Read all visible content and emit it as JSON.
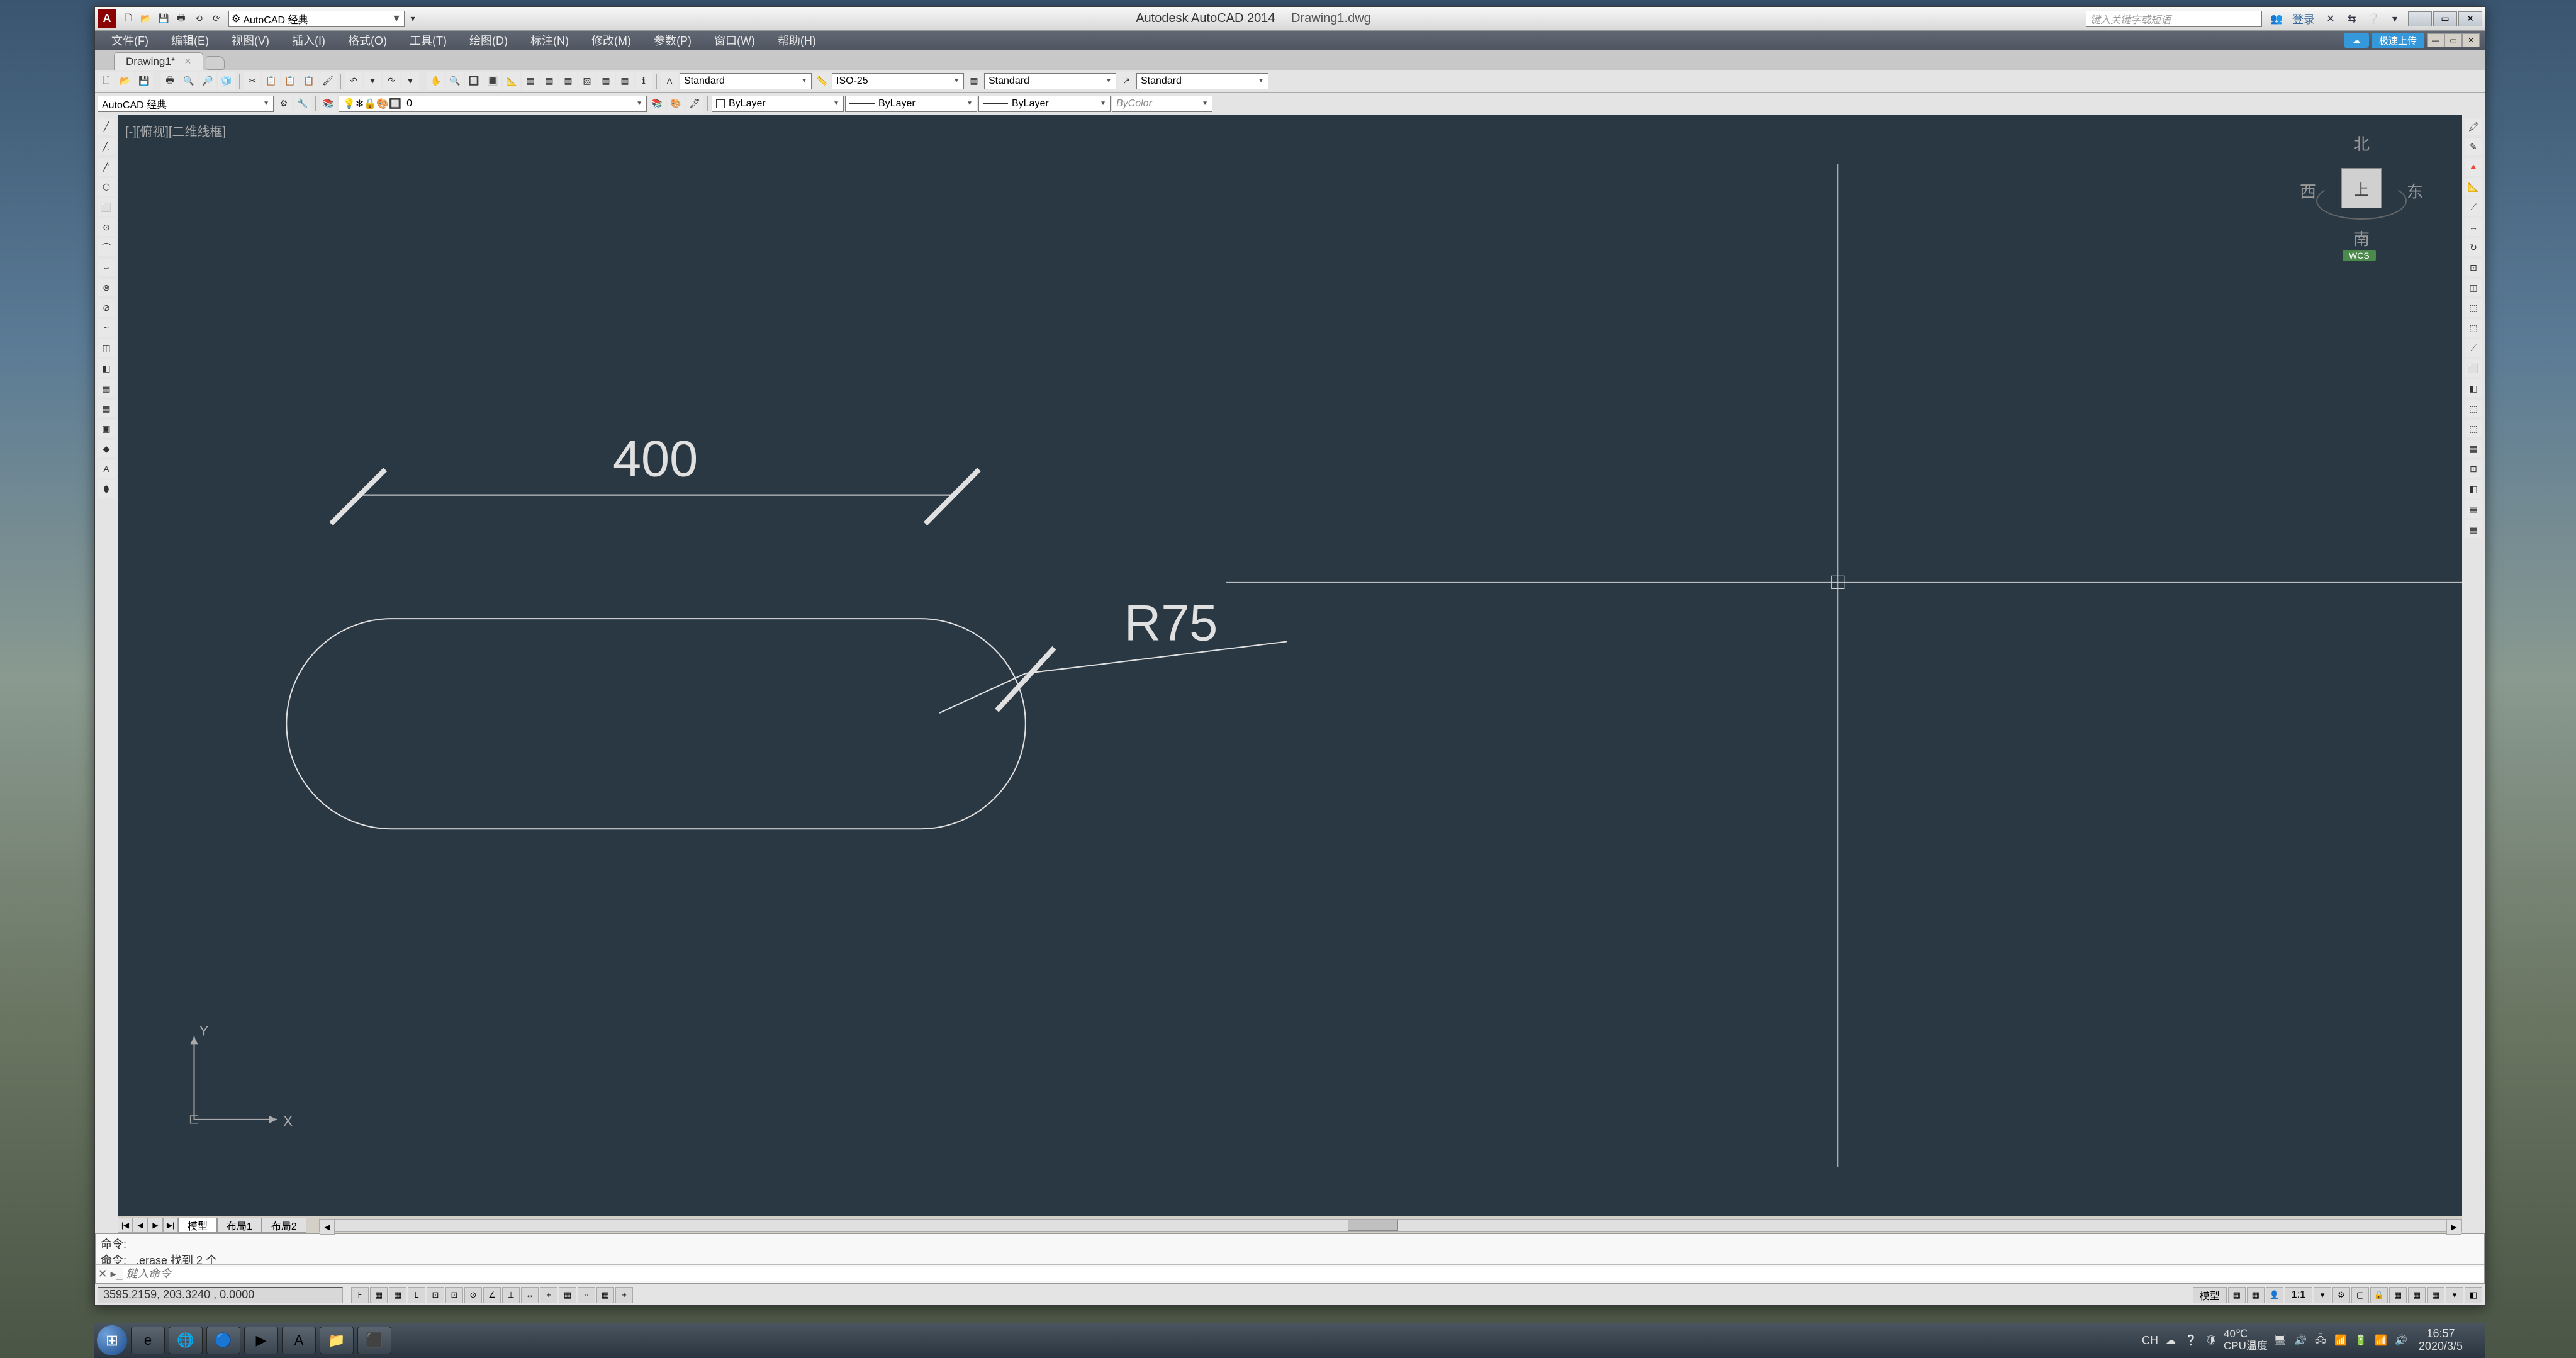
{
  "title_bar": {
    "logo": "A",
    "qat": [
      "🗋",
      "📂",
      "💾",
      "🖶",
      "⟲",
      "⟳",
      "▾"
    ],
    "workspace_dd": "AutoCAD 经典",
    "app_name": "Autodesk AutoCAD 2014",
    "doc_name": "Drawing1.dwg",
    "search_placeholder": "键入关键字或短语",
    "login_text": "登录",
    "right_icons": [
      "👥",
      "✕",
      "⇆",
      "❔",
      "▾"
    ]
  },
  "menu": {
    "items": [
      "文件(F)",
      "编辑(E)",
      "视图(V)",
      "插入(I)",
      "格式(O)",
      "工具(T)",
      "绘图(D)",
      "标注(N)",
      "修改(M)",
      "参数(P)",
      "窗口(W)",
      "帮助(H)"
    ],
    "upload_badge": "极速上传"
  },
  "doc_tabs": {
    "active": "Drawing1*",
    "close": "✕"
  },
  "toolbar1": {
    "file_icons": [
      "🗋",
      "📂",
      "💾",
      "🖶",
      "🔍",
      "🔎",
      "🧊"
    ],
    "edit_icons": [
      "✂",
      "📋",
      "📋",
      "📋",
      "🖌",
      "↶",
      "▾",
      "↷",
      "▾"
    ],
    "view_icons": [
      "✋",
      "🔍",
      "🔲",
      "🔳",
      "📐",
      "▦",
      "▦",
      "▦",
      "▧",
      "▦",
      "▦",
      "ℹ"
    ],
    "text_style": "Standard",
    "dim_style": "ISO-25",
    "table_style": "Standard",
    "mleader_style": "Standard"
  },
  "toolbar2": {
    "workspace": "AutoCAD 经典",
    "ws_icons": [
      "⚙",
      "🔧"
    ],
    "layer_icons": [
      "💡",
      "❄",
      "🔒",
      "🎨",
      "🔲"
    ],
    "layer_text": "0",
    "layer_btns": [
      "📚",
      "🎨",
      "🖋"
    ],
    "color_dd": "ByLayer",
    "linetype_dd": "ByLayer",
    "lineweight_dd": "ByLayer",
    "plot_dd": "ByColor"
  },
  "left_tools": [
    "╱",
    "╱.",
    "╱'",
    "⬡",
    "⬜",
    "⊙",
    "⌒",
    "⌣",
    "⊗",
    "⊘",
    "~",
    "◫",
    "◧",
    "▦",
    "▦",
    "▣",
    "◆",
    "A",
    "⬮"
  ],
  "right_tools": [
    "🖍",
    "✎",
    "🔺",
    "📐",
    "⟋",
    "↔",
    "↻",
    "⊡",
    "◫",
    "⬚",
    "⬚",
    "⟋",
    "⬜",
    "◧",
    "⬚",
    "⬚",
    "▦",
    "⊡",
    "◧",
    "▦",
    "▦"
  ],
  "viewport": {
    "label": "[-][俯视][二维线框]",
    "dim400": "400",
    "dimR75": "R75",
    "ucs_x": "X",
    "ucs_y": "Y",
    "viewcube": {
      "n": "北",
      "s": "南",
      "e": "东",
      "w": "西",
      "top": "上",
      "wcs": "WCS"
    }
  },
  "sheet_tabs": {
    "nav": [
      "|◀",
      "◀",
      "▶",
      "▶|"
    ],
    "tabs": [
      "模型",
      "布局1",
      "布局2"
    ]
  },
  "command": {
    "hist1": "命令:",
    "hist2": "命令: _.erase 找到 2 个",
    "prompt": "键入命令"
  },
  "status_bar": {
    "coords": "3595.2159, 203.3240 , 0.0000",
    "toggles": [
      "⊦",
      "▦",
      "▦",
      "L",
      "⊡",
      "⊡",
      "⊙",
      "∠",
      "⊥",
      "↔",
      "+",
      "▦",
      "▫",
      "▦",
      "+"
    ],
    "right": {
      "model": "模型",
      "icons": [
        "▦",
        "▦",
        "👤",
        "1:1",
        "▾",
        "⚙",
        "▢",
        "🔒",
        "▦",
        "▦",
        "▦",
        "▾",
        "◧"
      ]
    }
  },
  "taskbar": {
    "start": "⊞",
    "items_icons": [
      "e",
      "🌐",
      "🔵",
      "▶",
      "A",
      "📁",
      "⬛"
    ],
    "items_names": [
      "ie",
      "chrome",
      "app",
      "media",
      "autocad",
      "explorer",
      "recorder"
    ],
    "tray": {
      "lang": "CH",
      "icons": [
        "☁",
        "❔",
        "🛡",
        "🖥",
        "🔊",
        "🖧",
        "📶",
        "🔋",
        "📶",
        "🔊"
      ],
      "temp1": "40℃",
      "temp2": "CPU温度",
      "time": "16:57",
      "date": "2020/3/5"
    }
  }
}
